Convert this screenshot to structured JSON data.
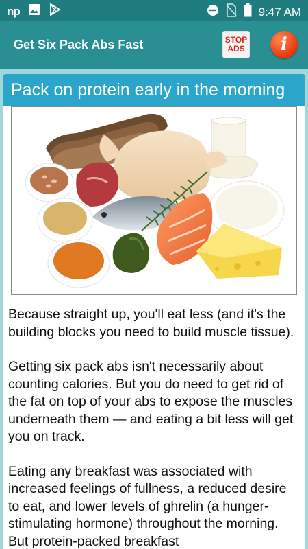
{
  "status_bar": {
    "left_icons": [
      "np-logo",
      "image-icon",
      "play-store-icon"
    ],
    "right_icons": [
      "do-not-disturb-icon",
      "no-sim-icon",
      "battery-icon"
    ],
    "time": "9:47 AM",
    "np_label": "np"
  },
  "toolbar": {
    "title": "Get Six Pack Abs Fast",
    "stop_ads_line1": "STOP",
    "stop_ads_line2": "ADS",
    "info_label": "i"
  },
  "article": {
    "title": "Pack on protein early in the morning",
    "image_subject": "protein foods",
    "paragraphs": [
      "Because straight up, you'll eat less (and it's the building blocks you need to build muscle tissue).",
      "Getting six pack abs isn't necessarily about counting calories. But you do need to get rid of the fat on top of your abs to expose the muscles underneath them — and eating a bit less will get you on track.",
      "Eating any breakfast was associated with increased feelings of fullness, a reduced desire to eat, and lower levels of ghrelin (a hunger-stimulating hormone) throughout the morning. But protein-packed breakfast"
    ]
  },
  "colors": {
    "status_bar": "#1f7d80",
    "toolbar": "#2a8f93",
    "card_title": "#29a6c9",
    "background": "#9fd7dc"
  }
}
